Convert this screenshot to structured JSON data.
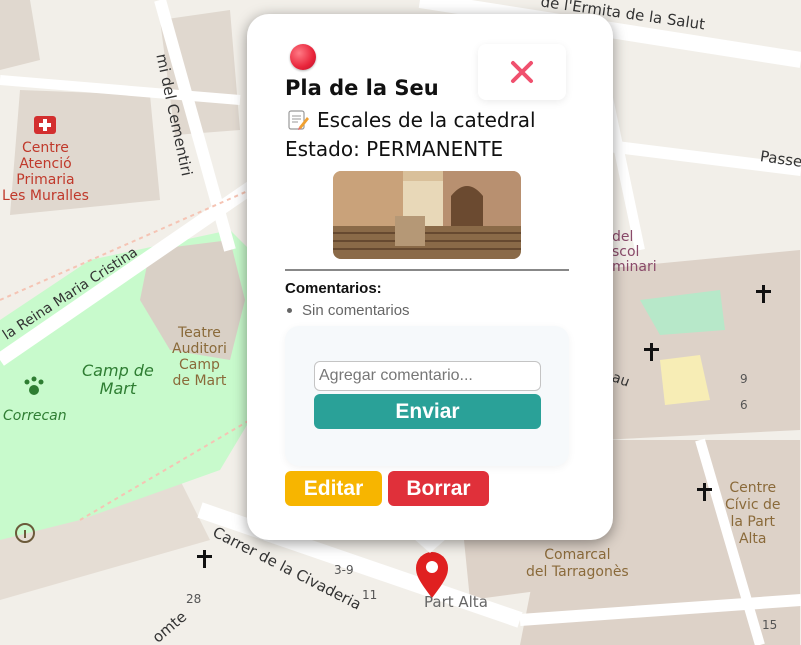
{
  "map": {
    "labels": {
      "ermita": "de l'Ermita de la Salut",
      "cementiri": "mi del Cementiri",
      "passeig": "Passe",
      "centre_atencio": "Centre\nAtenció\nPrimaria\nLes Muralles",
      "reina": "la Reina Maria Cristina",
      "teatre": "Teatre\nAuditori\nCamp\nde Mart",
      "camp_mart": "Camp de\nMart",
      "correcan": "Correcan",
      "del_escol": "del\nscol\nminari",
      "pau": "au",
      "n9": "9",
      "n6": "6",
      "centre_civic": "Centre\nCívic de\nla Part\nAlta",
      "comarcal": "Comarcal\ndel Tarragonès",
      "carrer_civ": "Carrer de la Civaderia",
      "n39": "3-9",
      "n11": "11",
      "part_alta": "Part Alta",
      "n28": "28",
      "n15": "15",
      "comte": "omte"
    },
    "accent_colors": {
      "park": "#c8facc",
      "pin": "#e02020"
    }
  },
  "popup": {
    "status_color": "#e8243a",
    "close_icon": "close-icon",
    "title": "Pla de la Seu",
    "description_icon": "memo-icon",
    "description": "Escales de la catedral",
    "estado": "Estado: PERMANENTE",
    "photo_alt": "catedral",
    "comments_title": "Comentarios:",
    "comments": [
      "Sin comentarios"
    ],
    "comment_input_placeholder": "Agregar comentario...",
    "send_label": "Enviar",
    "edit_label": "Editar",
    "delete_label": "Borrar"
  }
}
